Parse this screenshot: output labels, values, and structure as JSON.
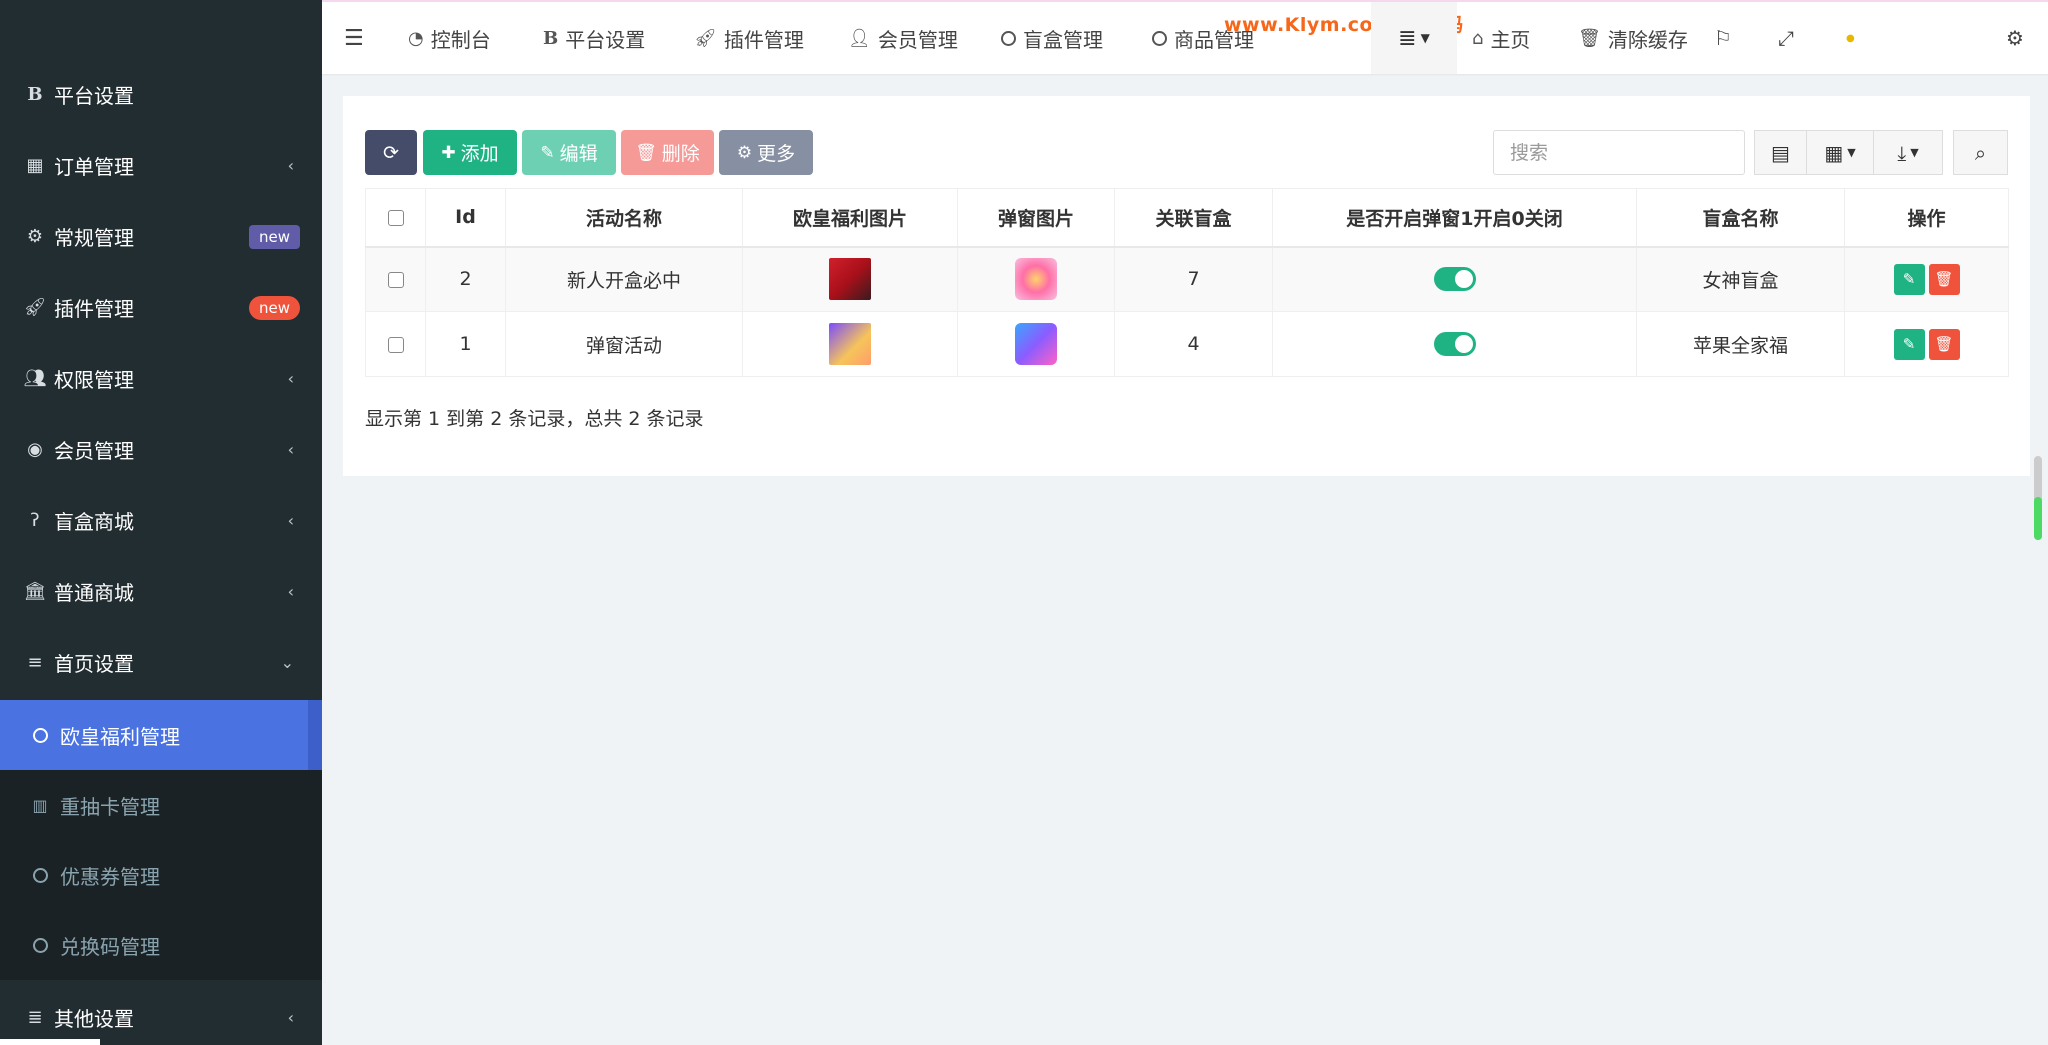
{
  "sidebar": {
    "items": [
      {
        "label": "平台设置",
        "icon": "bold-b-icon"
      },
      {
        "label": "订单管理",
        "icon": "table-icon"
      },
      {
        "label": "常规管理",
        "icon": "cogs-icon",
        "badge": "new"
      },
      {
        "label": "插件管理",
        "icon": "rocket-icon",
        "badge": "new"
      },
      {
        "label": "权限管理",
        "icon": "users-icon"
      },
      {
        "label": "会员管理",
        "icon": "user-circle-icon"
      },
      {
        "label": "盲盒商城",
        "icon": "hearing-icon"
      },
      {
        "label": "普通商城",
        "icon": "bank-icon"
      },
      {
        "label": "首页设置",
        "icon": "list-icon"
      },
      {
        "label": "其他设置",
        "icon": "database-icon"
      }
    ],
    "sub_items": [
      {
        "label": "欧皇福利管理",
        "active": true
      },
      {
        "label": "重抽卡管理"
      },
      {
        "label": "优惠券管理"
      },
      {
        "label": "兑换码管理"
      }
    ]
  },
  "header": {
    "tabs": [
      {
        "label": "控制台",
        "icon": "dashboard-icon"
      },
      {
        "label": "平台设置",
        "icon": "bold-b-icon"
      },
      {
        "label": "插件管理",
        "icon": "rocket-icon"
      },
      {
        "label": "会员管理",
        "icon": "user-icon"
      },
      {
        "label": "盲盒管理",
        "icon": "circle-icon"
      },
      {
        "label": "商品管理",
        "icon": "circle-icon"
      }
    ],
    "home_label": "主页",
    "clear_cache_label": "清除缓存",
    "watermark": "www.Klym.com-KI源码"
  },
  "toolbar": {
    "add_label": "添加",
    "edit_label": "编辑",
    "delete_label": "删除",
    "more_label": "更多",
    "search_placeholder": "搜索"
  },
  "table": {
    "columns": [
      "Id",
      "活动名称",
      "欧皇福利图片",
      "弹窗图片",
      "关联盲盒",
      "是否开启弹窗1开启0关闭",
      "盲盒名称",
      "操作"
    ],
    "rows": [
      {
        "id": "2",
        "name": "新人开盒必中",
        "related_box": "7",
        "popup_enabled": true,
        "box_name": "女神盲盒"
      },
      {
        "id": "1",
        "name": "弹窗活动",
        "related_box": "4",
        "popup_enabled": true,
        "box_name": "苹果全家福"
      }
    ],
    "summary": "显示第 1 到第 2 条记录，总共 2 条记录"
  },
  "colors": {
    "sidebar_bg": "#222d32",
    "active_item": "#4a72e0",
    "primary_green": "#1fb384",
    "danger_red": "#f0533c"
  }
}
